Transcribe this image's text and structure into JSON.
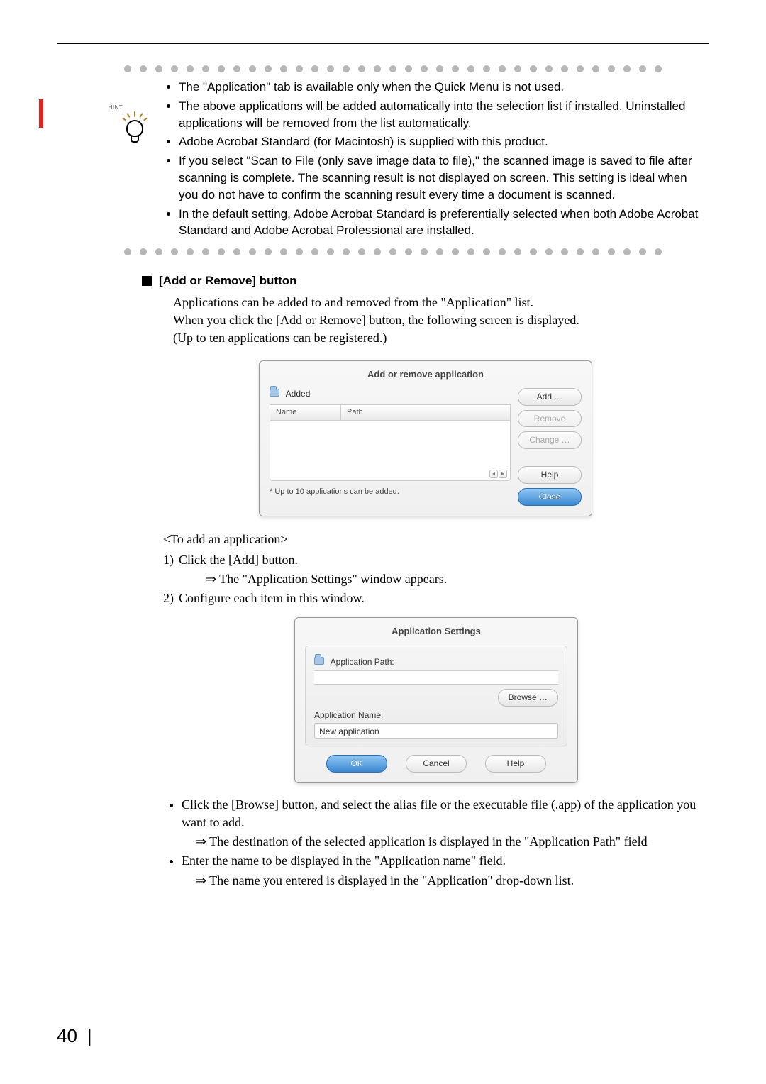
{
  "page_number": "40",
  "hint_label": "HINT",
  "hints": [
    "The \"Application\" tab is available only when the Quick Menu is not used.",
    "The above applications will be added automatically into the selection list if installed. Uninstalled applications will be removed from the list automatically.",
    "Adobe Acrobat Standard (for Macintosh) is supplied with this product.",
    "If you select \"Scan to File (only save image data to file),\" the scanned image is saved to file after scanning is complete. The scanning result is not displayed on screen. This setting is ideal when you do not have to confirm the scanning result every time a document is scanned.",
    "In the default setting, Adobe Acrobat Standard is preferentially selected when both Adobe Acrobat Standard and Adobe Acrobat Professional are installed."
  ],
  "section": {
    "heading": "[Add or Remove] button",
    "body": [
      "Applications can be added to and removed from the \"Application\" list.",
      "When you click the [Add or Remove] button, the following screen is displayed.",
      "(Up to ten applications can be registered.)"
    ]
  },
  "dialog1": {
    "title": "Add or remove application",
    "folder_label": "Added",
    "col_name": "Name",
    "col_path": "Path",
    "btn_add": "Add …",
    "btn_remove": "Remove",
    "btn_change": "Change …",
    "btn_help": "Help",
    "btn_close": "Close",
    "footnote": "* Up to 10 applications can be added."
  },
  "proc": {
    "subhead": "<To add an application>",
    "step1": "Click the [Add] button.",
    "step1_result": "The \"Application Settings\" window appears.",
    "step2": "Configure each item in this window."
  },
  "dialog2": {
    "title": "Application Settings",
    "path_label": "Application Path:",
    "btn_browse": "Browse …",
    "name_label": "Application Name:",
    "name_value": "New application",
    "btn_ok": "OK",
    "btn_cancel": "Cancel",
    "btn_help": "Help"
  },
  "post": {
    "bullet1": "Click the [Browse] button, and select the alias file or the executable file (.app) of the application you want to add.",
    "bullet1_result": "The destination of the selected application is displayed in the \"Application Path\" field",
    "bullet2": "Enter the name to be displayed in the \"Application name\" field.",
    "bullet2_result": "The name you entered is displayed in the \"Application\" drop-down list."
  }
}
